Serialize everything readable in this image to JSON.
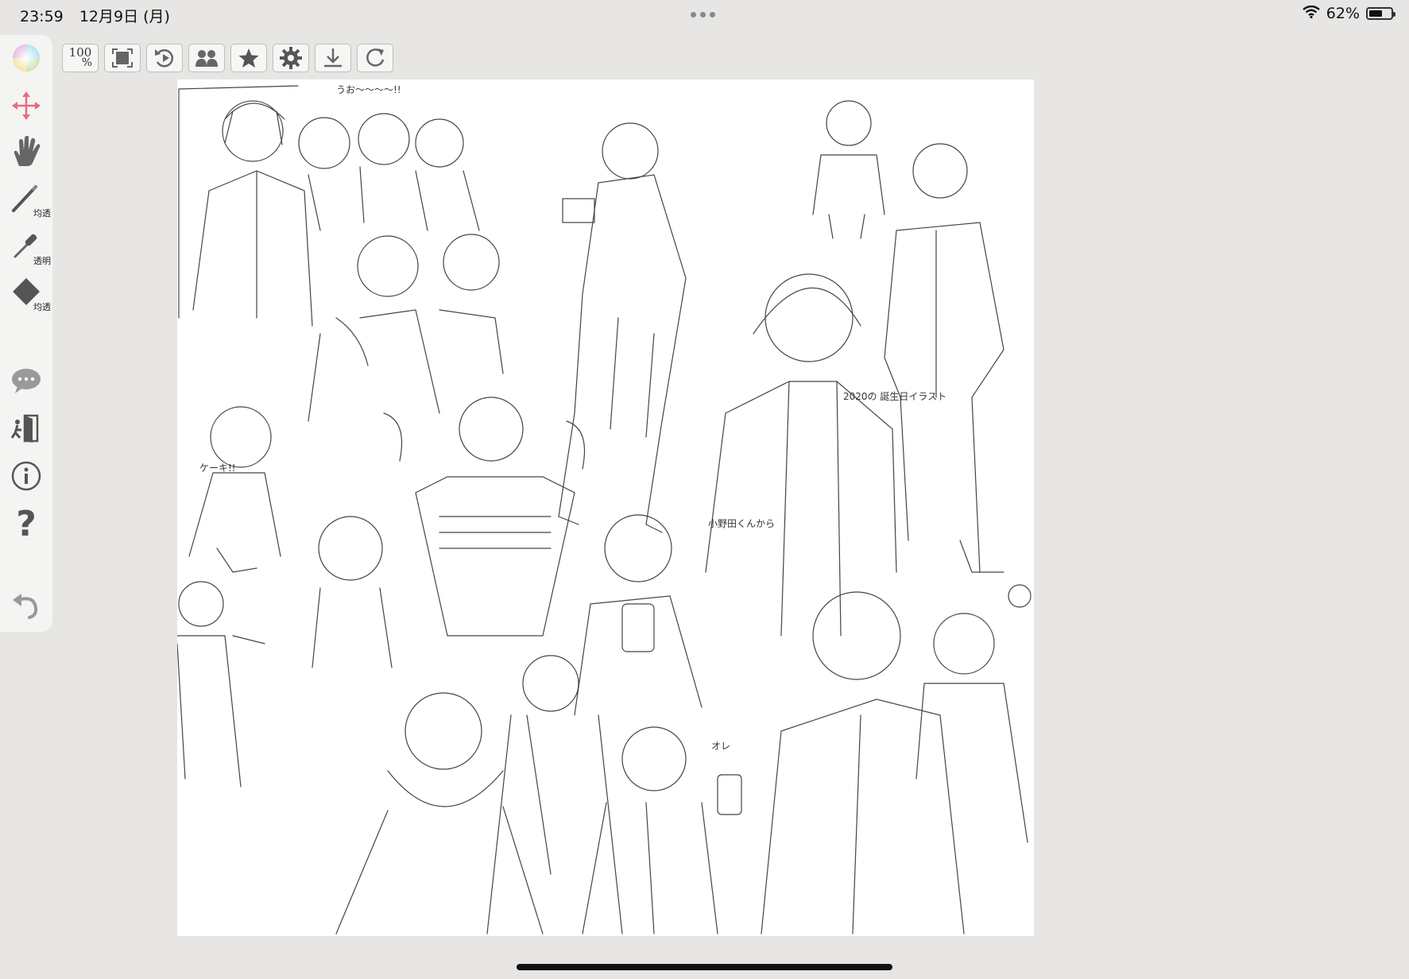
{
  "status_bar": {
    "time": "23:59",
    "date": "12月9日 (月)",
    "battery_percent": "62%",
    "battery_level": 0.62,
    "icons": [
      "more-dots-icon",
      "wifi-icon",
      "battery-icon"
    ]
  },
  "tools": {
    "color_wheel": {
      "icon": "color-wheel-icon"
    },
    "move": {
      "icon": "move-arrows-icon",
      "color": "#e96b7c"
    },
    "hand": {
      "icon": "hand-icon"
    },
    "pen": {
      "icon": "pen-icon",
      "label": "均透"
    },
    "eyedropper": {
      "icon": "eyedropper-icon",
      "label": "透明"
    },
    "eraser": {
      "icon": "eraser-icon",
      "label": "均透"
    },
    "comment": {
      "icon": "speech-bubble-icon"
    },
    "exit": {
      "icon": "exit-door-icon"
    },
    "info": {
      "icon": "info-icon"
    },
    "help": {
      "icon": "help-question-icon",
      "label": "?"
    },
    "undo": {
      "icon": "undo-icon"
    }
  },
  "toolbar": {
    "zoom_value": "100",
    "zoom_unit": "%",
    "buttons": [
      "zoom-100-button",
      "fit-screen-button",
      "rotate-reset-button",
      "users-button",
      "favorite-star-button",
      "settings-gear-button",
      "download-button",
      "refresh-button"
    ]
  },
  "canvas": {
    "background": "#ffffff",
    "handwritten_notes": [
      "うお〜〜〜〜!!",
      "ケーキ!!",
      "2020の 誕生日イラスト",
      "小野田くんから",
      "オレ"
    ]
  }
}
